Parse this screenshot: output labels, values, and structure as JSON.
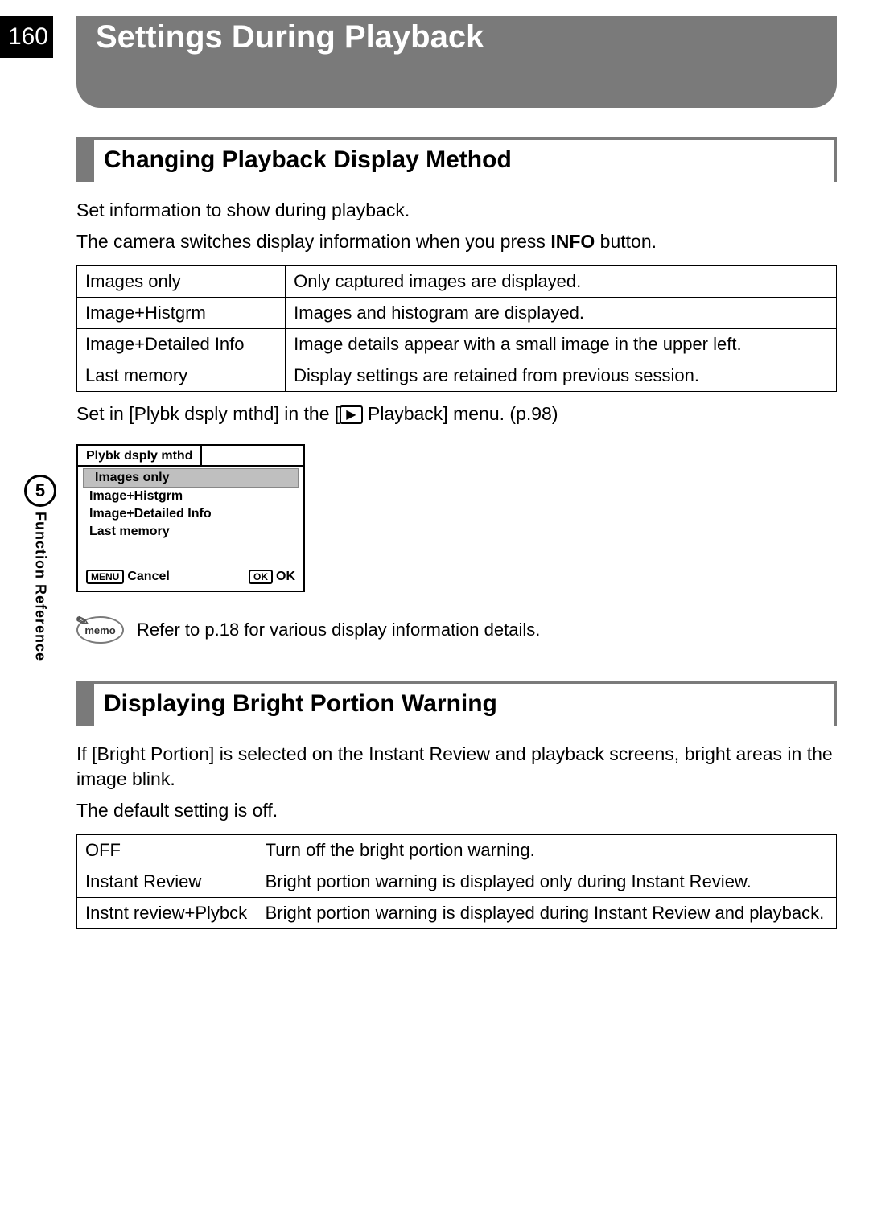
{
  "page_number": "160",
  "page_title": "Settings During Playback",
  "side_tab": {
    "number": "5",
    "label": "Function Reference"
  },
  "section1": {
    "heading": "Changing Playback Display Method",
    "intro1": "Set information to show during playback.",
    "intro2_a": "The camera switches display information when you press ",
    "intro2_b": "INFO",
    "intro2_c": " button.",
    "rows": [
      {
        "k": "Images only",
        "v": "Only captured images are displayed."
      },
      {
        "k": "Image+Histgrm",
        "v": "Images and histogram are displayed."
      },
      {
        "k": "Image+Detailed Info",
        "v": "Image details appear with a small image in the upper left."
      },
      {
        "k": "Last memory",
        "v": "Display settings are retained from previous session."
      }
    ],
    "menu_line_a": "Set in [Plybk dsply mthd] in the [",
    "menu_line_b": " Playback] menu. (p.98)"
  },
  "lcd": {
    "tab": "Plybk dsply mthd",
    "items": [
      "Images only",
      "Image+Histgrm",
      "Image+Detailed Info",
      "Last memory"
    ],
    "selected_index": 0,
    "menu_btn": "MENU",
    "cancel": "Cancel",
    "ok_btn": "OK",
    "ok": "OK"
  },
  "memo": {
    "label": "memo",
    "text": "Refer to p.18 for various display information details."
  },
  "section2": {
    "heading": "Displaying Bright Portion Warning",
    "intro1": "If [Bright Portion] is selected on the Instant Review and playback screens, bright areas in the image blink.",
    "intro2": "The default setting is off.",
    "rows": [
      {
        "k": "OFF",
        "v": "Turn off the bright portion warning."
      },
      {
        "k": "Instant Review",
        "v": "Bright portion warning is displayed only during Instant Review."
      },
      {
        "k": "Instnt review+Plybck",
        "v": "Bright portion warning is displayed during Instant Review and playback."
      }
    ]
  }
}
